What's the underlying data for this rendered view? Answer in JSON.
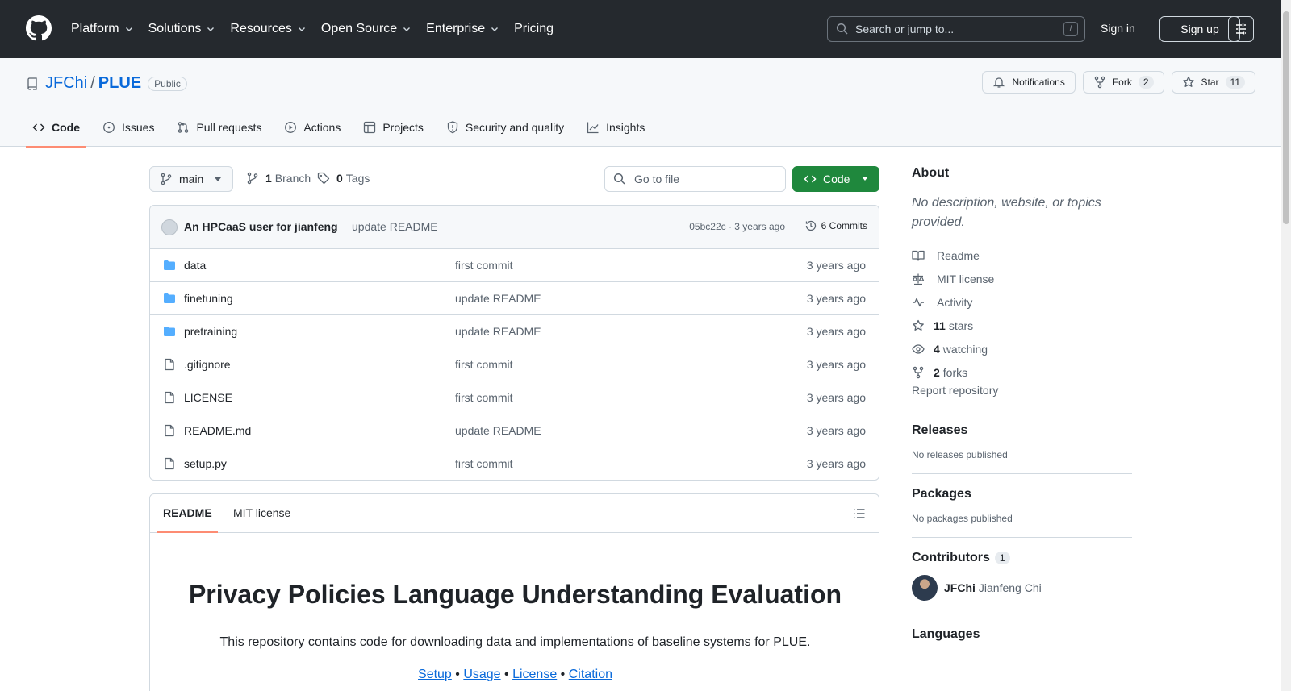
{
  "header": {
    "nav": [
      {
        "label": "Platform",
        "dropdown": true
      },
      {
        "label": "Solutions",
        "dropdown": true
      },
      {
        "label": "Resources",
        "dropdown": true
      },
      {
        "label": "Open Source",
        "dropdown": true
      },
      {
        "label": "Enterprise",
        "dropdown": true
      },
      {
        "label": "Pricing",
        "dropdown": false
      }
    ],
    "search_placeholder": "Search or jump to...",
    "search_shortcut": "/",
    "signin": "Sign in",
    "signup": "Sign up"
  },
  "repo": {
    "owner": "JFChi",
    "separator": "/",
    "name": "PLUE",
    "visibility": "Public",
    "notifications_label": "Notifications",
    "fork_label": "Fork",
    "fork_count": "2",
    "star_label": "Star",
    "star_count": "11",
    "tabs": [
      {
        "label": "Code",
        "icon": "code-icon",
        "active": true
      },
      {
        "label": "Issues",
        "icon": "issue-icon",
        "active": false
      },
      {
        "label": "Pull requests",
        "icon": "pull-request-icon",
        "active": false
      },
      {
        "label": "Actions",
        "icon": "play-icon",
        "active": false
      },
      {
        "label": "Projects",
        "icon": "table-icon",
        "active": false
      },
      {
        "label": "Security and quality",
        "icon": "shield-icon",
        "active": false
      },
      {
        "label": "Insights",
        "icon": "graph-icon",
        "active": false
      }
    ]
  },
  "toolbar": {
    "branch": "main",
    "branches_count": "1",
    "branches_label": "Branch",
    "tags_count": "0",
    "tags_label": "Tags",
    "goto_placeholder": "Go to file",
    "code_button": "Code"
  },
  "latest_commit": {
    "author": "An HPCaaS user for jianfeng",
    "message": "update README",
    "meta": "05bc22c · 3 years ago",
    "commits_label": "6 Commits"
  },
  "files": [
    {
      "name": "data",
      "type": "folder",
      "message": "first commit",
      "age": "3 years ago"
    },
    {
      "name": "finetuning",
      "type": "folder",
      "message": "update README",
      "age": "3 years ago"
    },
    {
      "name": "pretraining",
      "type": "folder",
      "message": "update README",
      "age": "3 years ago"
    },
    {
      "name": ".gitignore",
      "type": "file",
      "message": "first commit",
      "age": "3 years ago"
    },
    {
      "name": "LICENSE",
      "type": "file",
      "message": "first commit",
      "age": "3 years ago"
    },
    {
      "name": "README.md",
      "type": "file",
      "message": "update README",
      "age": "3 years ago"
    },
    {
      "name": "setup.py",
      "type": "file",
      "message": "first commit",
      "age": "3 years ago"
    }
  ],
  "readme": {
    "tab_readme": "README",
    "tab_license": "MIT license",
    "title": "Privacy Policies Language Understanding Evaluation",
    "intro": "This repository contains code for downloading data and implementations of baseline systems for PLUE.",
    "links": [
      "Setup",
      "Usage",
      "License",
      "Citation"
    ],
    "link_separator": " • "
  },
  "sidebar": {
    "about_title": "About",
    "about_desc": "No description, website, or topics provided.",
    "links": [
      {
        "icon": "book-icon",
        "count": "",
        "label": "Readme"
      },
      {
        "icon": "law-icon",
        "count": "",
        "label": "MIT license"
      },
      {
        "icon": "pulse-icon",
        "count": "",
        "label": "Activity"
      },
      {
        "icon": "star-icon",
        "count": "11",
        "label": "stars"
      },
      {
        "icon": "eye-icon",
        "count": "4",
        "label": "watching"
      },
      {
        "icon": "fork-icon",
        "count": "2",
        "label": "forks"
      }
    ],
    "report": "Report repository",
    "releases_title": "Releases",
    "releases_empty": "No releases published",
    "packages_title": "Packages",
    "packages_empty": "No packages published",
    "contributors_title": "Contributors",
    "contributors_count": "1",
    "contributor_login": "JFChi",
    "contributor_name": "Jianfeng Chi",
    "languages_title": "Languages"
  },
  "colors": {
    "header_bg": "#25292e",
    "link": "#0969da",
    "code_button": "#1f883d",
    "tab_underline": "#fd8c73",
    "folder": "#54aeff"
  }
}
